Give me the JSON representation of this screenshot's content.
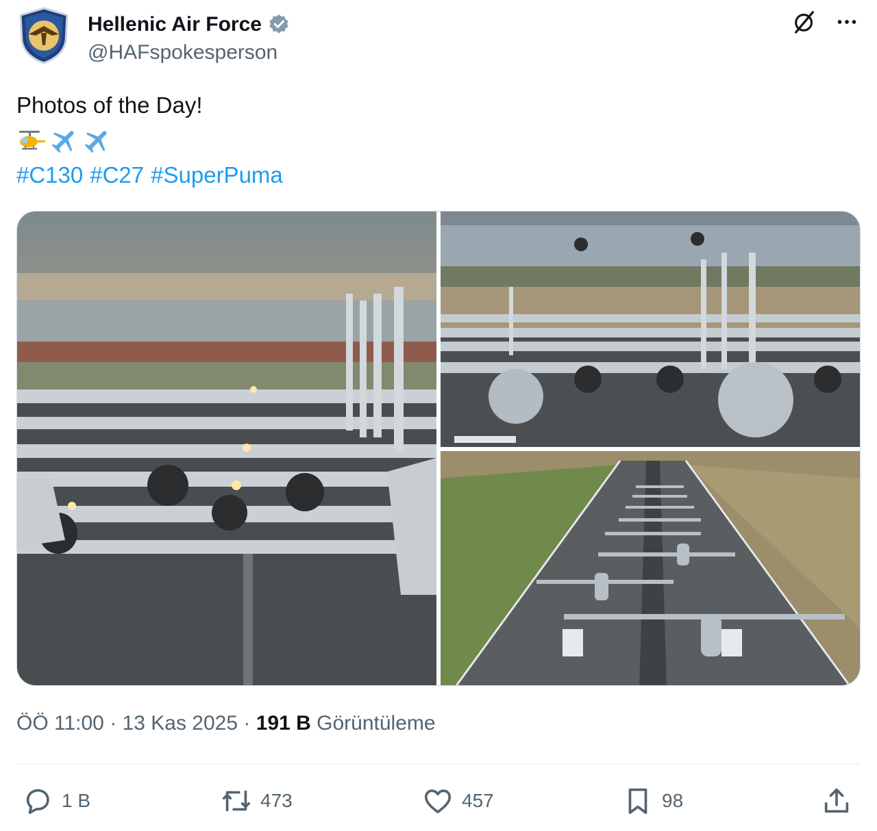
{
  "account": {
    "display_name": "Hellenic Air Force",
    "handle": "@HAFspokesperson",
    "verified": true
  },
  "tweet": {
    "text": "Photos of the Day!",
    "emojis": [
      "helicopter",
      "airplane",
      "airplane"
    ],
    "hashtags": [
      "#C130",
      "#C27",
      "#SuperPuma"
    ]
  },
  "media": {
    "photo_count": 3
  },
  "meta": {
    "time": "ÖÖ 11:00",
    "separator": "·",
    "date": "13 Kas 2025",
    "views_count": "191 B",
    "views_label": "Görüntüleme"
  },
  "actions": {
    "reply_count": "1 B",
    "retweet_count": "473",
    "like_count": "457",
    "bookmark_count": "98"
  },
  "colors": {
    "accent": "#1d9bf0",
    "secondary_text": "#536471",
    "primary_text": "#0f1419"
  },
  "icons": {
    "top_right": [
      "grok-icon",
      "more-icon"
    ],
    "action_bar": [
      "reply-icon",
      "retweet-icon",
      "like-icon",
      "bookmark-icon",
      "share-icon"
    ]
  }
}
